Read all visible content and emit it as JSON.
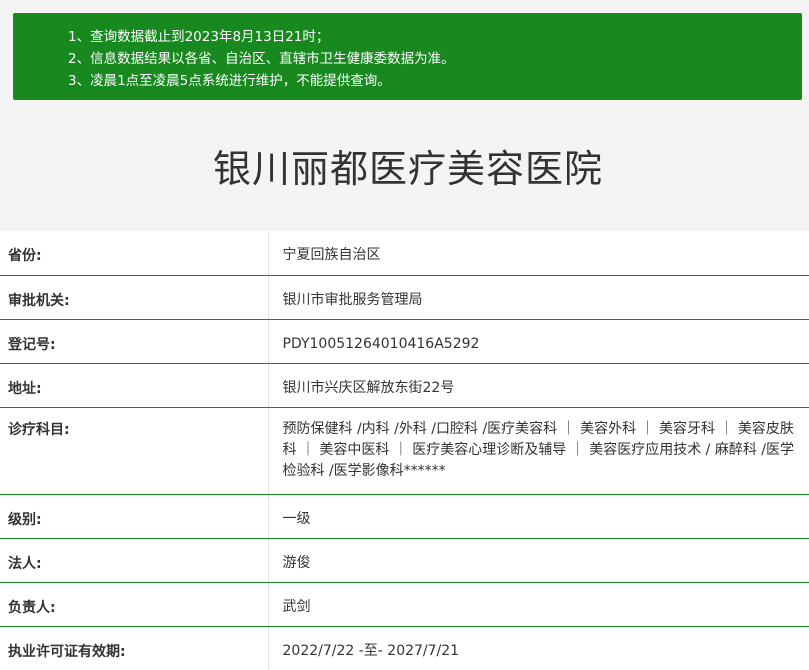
{
  "notice": {
    "lines": [
      "1、查询数据截止到2023年8月13日21时；",
      "2、信息数据结果以各省、自治区、直辖市卫生健康委数据为准。",
      "3、凌晨1点至凌晨5点系统进行维护，不能提供查询。"
    ]
  },
  "title": "银川丽都医疗美容医院",
  "rows": [
    {
      "label": "省份:",
      "value": "宁夏回族自治区"
    },
    {
      "label": "审批机关:",
      "value": "银川市审批服务管理局"
    },
    {
      "label": "登记号:",
      "value": "PDY10051264010416A5292"
    },
    {
      "label": "地址:",
      "value": "银川市兴庆区解放东街22号"
    },
    {
      "label": "诊疗科目:",
      "value": "预防保健科 /内科 /外科 /口腔科 /医疗美容科 ｜ 美容外科 ｜ 美容牙科 ｜ 美容皮肤科 ｜ 美容中医科 ｜ 医疗美容心理诊断及辅导 ｜ 美容医疗应用技术 / 麻醉科 /医学检验科 /医学影像科******"
    },
    {
      "label": "级别:",
      "value": "一级"
    },
    {
      "label": "法人:",
      "value": "游俊"
    },
    {
      "label": "负责人:",
      "value": "武剑"
    },
    {
      "label": "执业许可证有效期:",
      "value": "2022/7/22 -至- 2027/7/21"
    }
  ]
}
